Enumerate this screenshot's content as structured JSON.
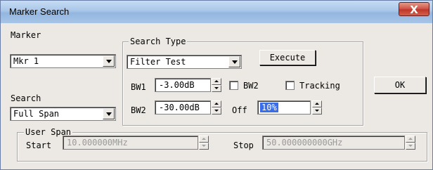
{
  "window": {
    "title": "Marker Search",
    "close_glyph": "X"
  },
  "marker": {
    "label": "Marker",
    "value": "Mkr 1"
  },
  "search": {
    "label": "Search",
    "value": "Full Span"
  },
  "search_type": {
    "group_label": "Search Type",
    "value": "Filter Test",
    "execute_label": "Execute"
  },
  "bw1": {
    "label": "BW1",
    "value": "-3.00dB"
  },
  "bw2_check": {
    "label": "BW2",
    "checked": false
  },
  "tracking_check": {
    "label": "Tracking",
    "checked": false
  },
  "bw2": {
    "label": "BW2",
    "value": "-30.00dB"
  },
  "off": {
    "label": "Off",
    "value": "10%"
  },
  "ok_label": "OK",
  "user_span": {
    "group_label": "User Span",
    "start_label": "Start",
    "start_value": "10.000000MHz",
    "stop_label": "Stop",
    "stop_value": "50.000000000GHz"
  },
  "colors": {
    "selection": "#3a6ee8",
    "close_button": "#c0362a",
    "titlebar": "#a9c6e8"
  }
}
